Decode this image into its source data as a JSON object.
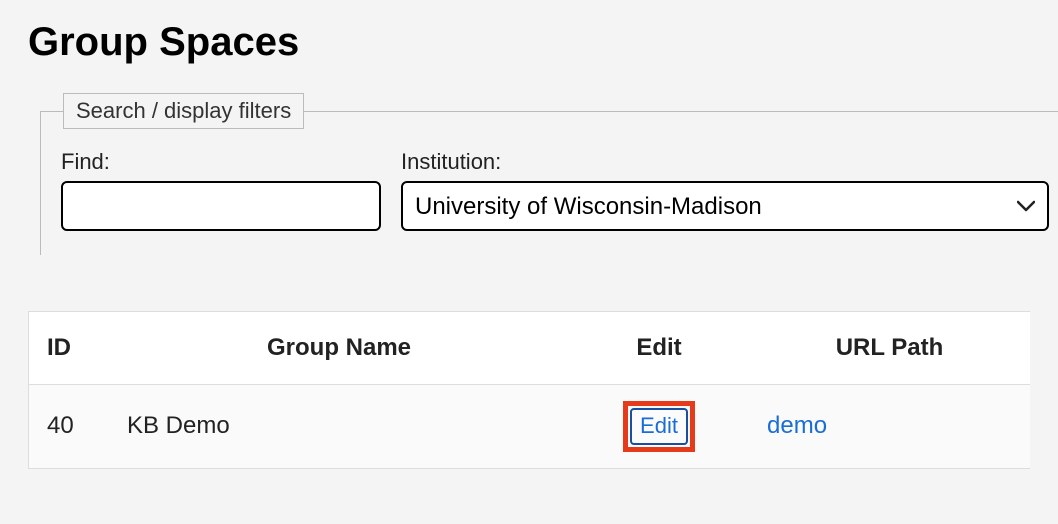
{
  "page": {
    "title": "Group Spaces"
  },
  "filters": {
    "legend": "Search / display filters",
    "find": {
      "label": "Find:",
      "value": ""
    },
    "institution": {
      "label": "Institution:",
      "selected": "University of Wisconsin-Madison"
    }
  },
  "table": {
    "headers": {
      "id": "ID",
      "group_name": "Group Name",
      "edit": "Edit",
      "url_path": "URL Path"
    },
    "rows": [
      {
        "id": "40",
        "group_name": "KB Demo",
        "edit_label": "Edit",
        "url_path": "demo"
      }
    ]
  }
}
